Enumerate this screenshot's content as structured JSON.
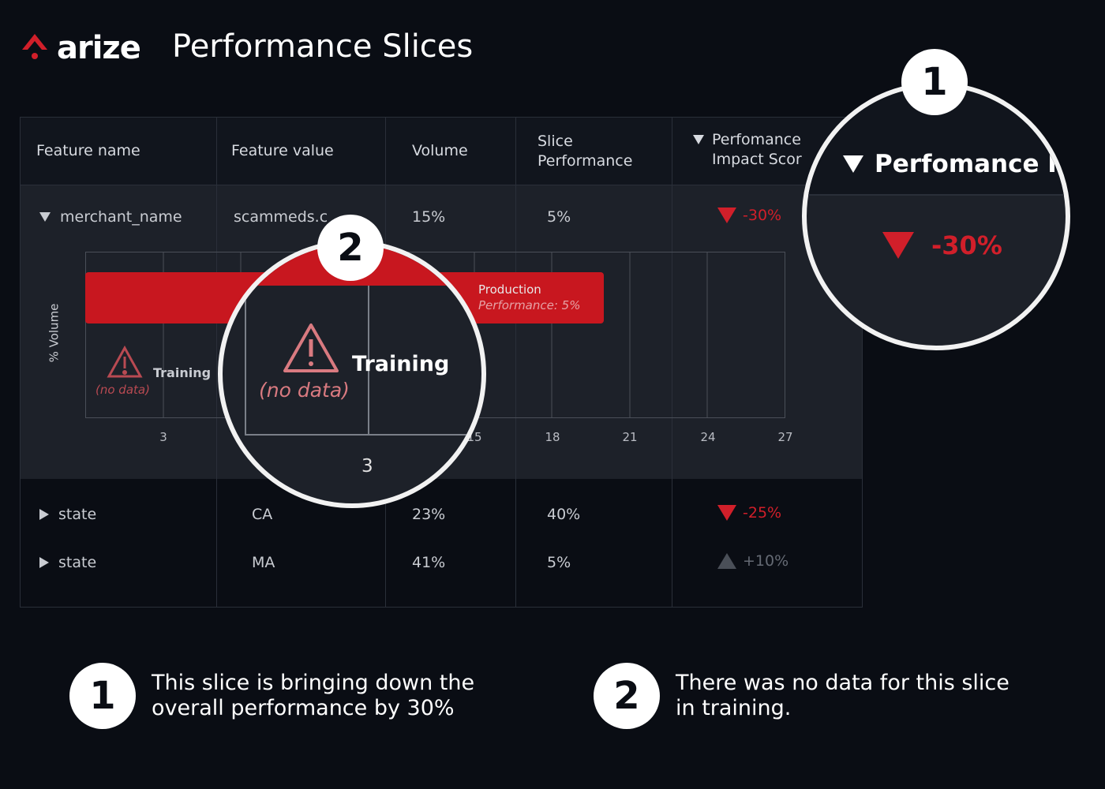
{
  "brand": {
    "name": "arize",
    "accent": "#d11f2a"
  },
  "page_title": "Performance Slices",
  "table": {
    "headers": {
      "feature_name": "Feature name",
      "feature_value": "Feature value",
      "volume": "Volume",
      "slice_perf_1": "Slice",
      "slice_perf_2": "Performance",
      "impact_1": "Perfomance",
      "impact_2": "Impact Scor"
    },
    "rows": [
      {
        "feature": "merchant_name",
        "value": "scammeds.c",
        "volume": "15%",
        "slice_performance": "5%",
        "impact": "-30%",
        "direction": "down",
        "expanded": true
      },
      {
        "feature": "state",
        "value": "CA",
        "volume": "23%",
        "slice_performance": "40%",
        "impact": "-25%",
        "direction": "down",
        "expanded": false
      },
      {
        "feature": "state",
        "value": "MA",
        "volume": "41%",
        "slice_performance": "5%",
        "impact": "+10%",
        "direction": "up",
        "expanded": false
      }
    ]
  },
  "chart": {
    "y_label": "% Volume",
    "x_ticks": [
      "3",
      "15",
      "18",
      "21",
      "24",
      "27"
    ],
    "production_label": "Production",
    "production_perf": "Performance: 5%",
    "training_label": "Training",
    "no_data": "(no data)"
  },
  "zoom1": {
    "badge": "1",
    "header": "Perfomance I",
    "value": "-30%"
  },
  "zoom2": {
    "badge": "2",
    "training": "Training",
    "no_data": "(no data)",
    "tick": "3"
  },
  "callouts": [
    {
      "number": "1",
      "line1": "This slice is bringing down the",
      "line2": "overall performance by 30%"
    },
    {
      "number": "2",
      "line1": "There was no data for this slice",
      "line2": "in training."
    }
  ]
}
